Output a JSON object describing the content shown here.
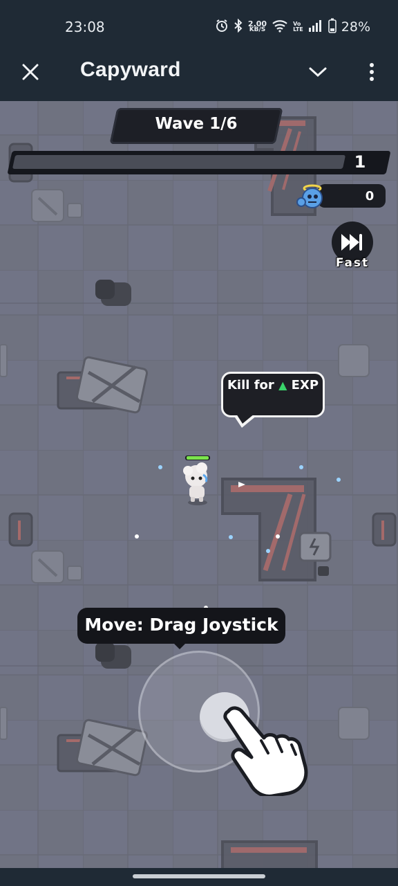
{
  "status_bar": {
    "time": "23:08",
    "network_speed_value": "2.00",
    "network_speed_unit": "KB/S",
    "volte_top": "Vo",
    "volte_bottom": "LTE",
    "battery": "28%"
  },
  "app_bar": {
    "title": "Capyward"
  },
  "game": {
    "wave_label": "Wave 1/6",
    "level": "1",
    "xp_progress": 0,
    "kills": "0",
    "fast_label": "Fast",
    "bubble": {
      "prefix": "Kill for",
      "icon": "▲",
      "suffix": "EXP"
    },
    "tooltip": "Move: Drag Joystick",
    "colors": {
      "floor": "#6f7280",
      "hud_dark": "#1d1f26",
      "exp_green": "#39d36a"
    }
  }
}
